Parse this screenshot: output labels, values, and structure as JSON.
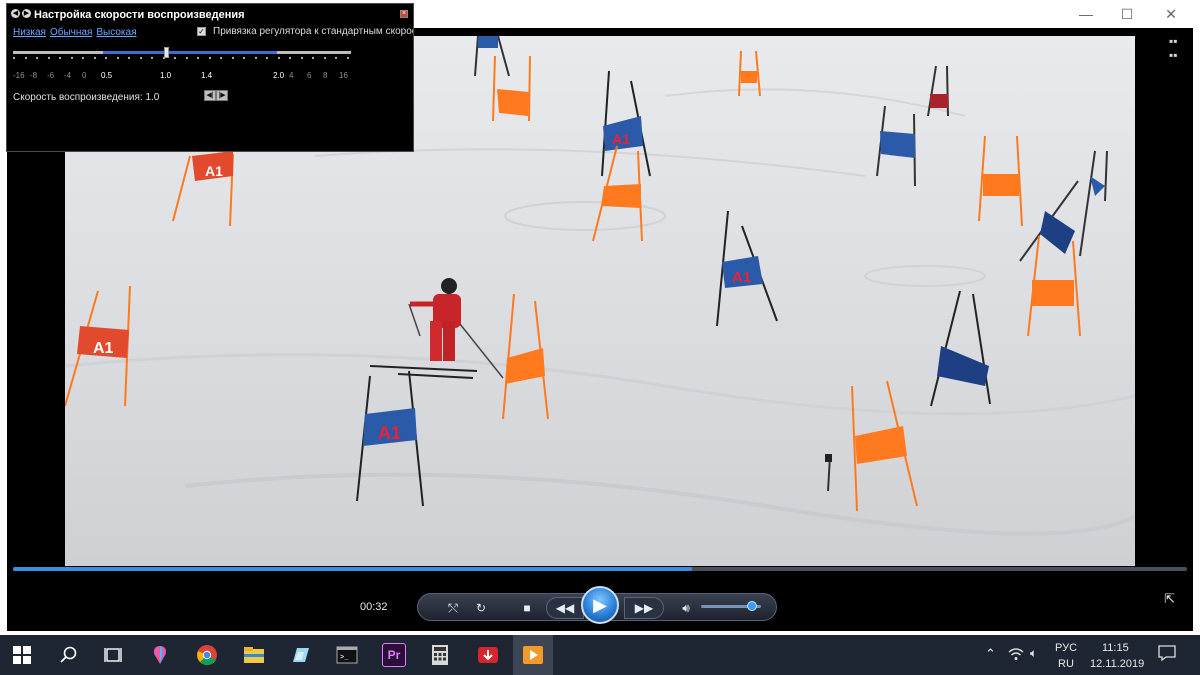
{
  "window": {
    "minimize": "—",
    "maximize": "☐",
    "close": "✕"
  },
  "speed_dialog": {
    "title": "Настройка скорости воспроизведения",
    "preset_low": "Низкая",
    "preset_normal": "Обычная",
    "preset_high": "Высокая",
    "snap_checked": "✓",
    "snap_label": "Привязка регулятора к стандартным скорос",
    "tick_labels": [
      "-16",
      "-8",
      "-6",
      "-4",
      "0",
      "0.5",
      "1.0",
      "1.4",
      "2.0",
      "4",
      "6",
      "8",
      "16"
    ],
    "rate_label": "Скорость воспроизведения: 1.0",
    "rate_value": 1.0,
    "rate_down": "◀|",
    "rate_up": "|▶"
  },
  "player": {
    "elapsed": "00:32",
    "seek_progress": 0.578,
    "volume": 0.85
  },
  "taskbar": {
    "language": "РУС",
    "layout": "RU",
    "time": "11:15",
    "date": "12.11.2019",
    "apps": [
      {
        "icon": "windows-logo-icon"
      },
      {
        "icon": "search-icon"
      },
      {
        "icon": "task-view-icon"
      },
      {
        "icon": "paint3d-icon"
      },
      {
        "icon": "chrome-icon"
      },
      {
        "icon": "file-explorer-icon"
      },
      {
        "icon": "photos-app-icon"
      },
      {
        "icon": "terminal-icon"
      },
      {
        "icon": "premiere-icon",
        "label": "Pr"
      },
      {
        "icon": "calculator-icon"
      },
      {
        "icon": "download-manager-icon"
      },
      {
        "icon": "media-player-icon"
      }
    ]
  },
  "colors": {
    "accent": "#3b8de0",
    "taskbar": "#1f2633",
    "gate_orange": "#ff7a1f",
    "gate_blue": "#2a5aa8"
  }
}
